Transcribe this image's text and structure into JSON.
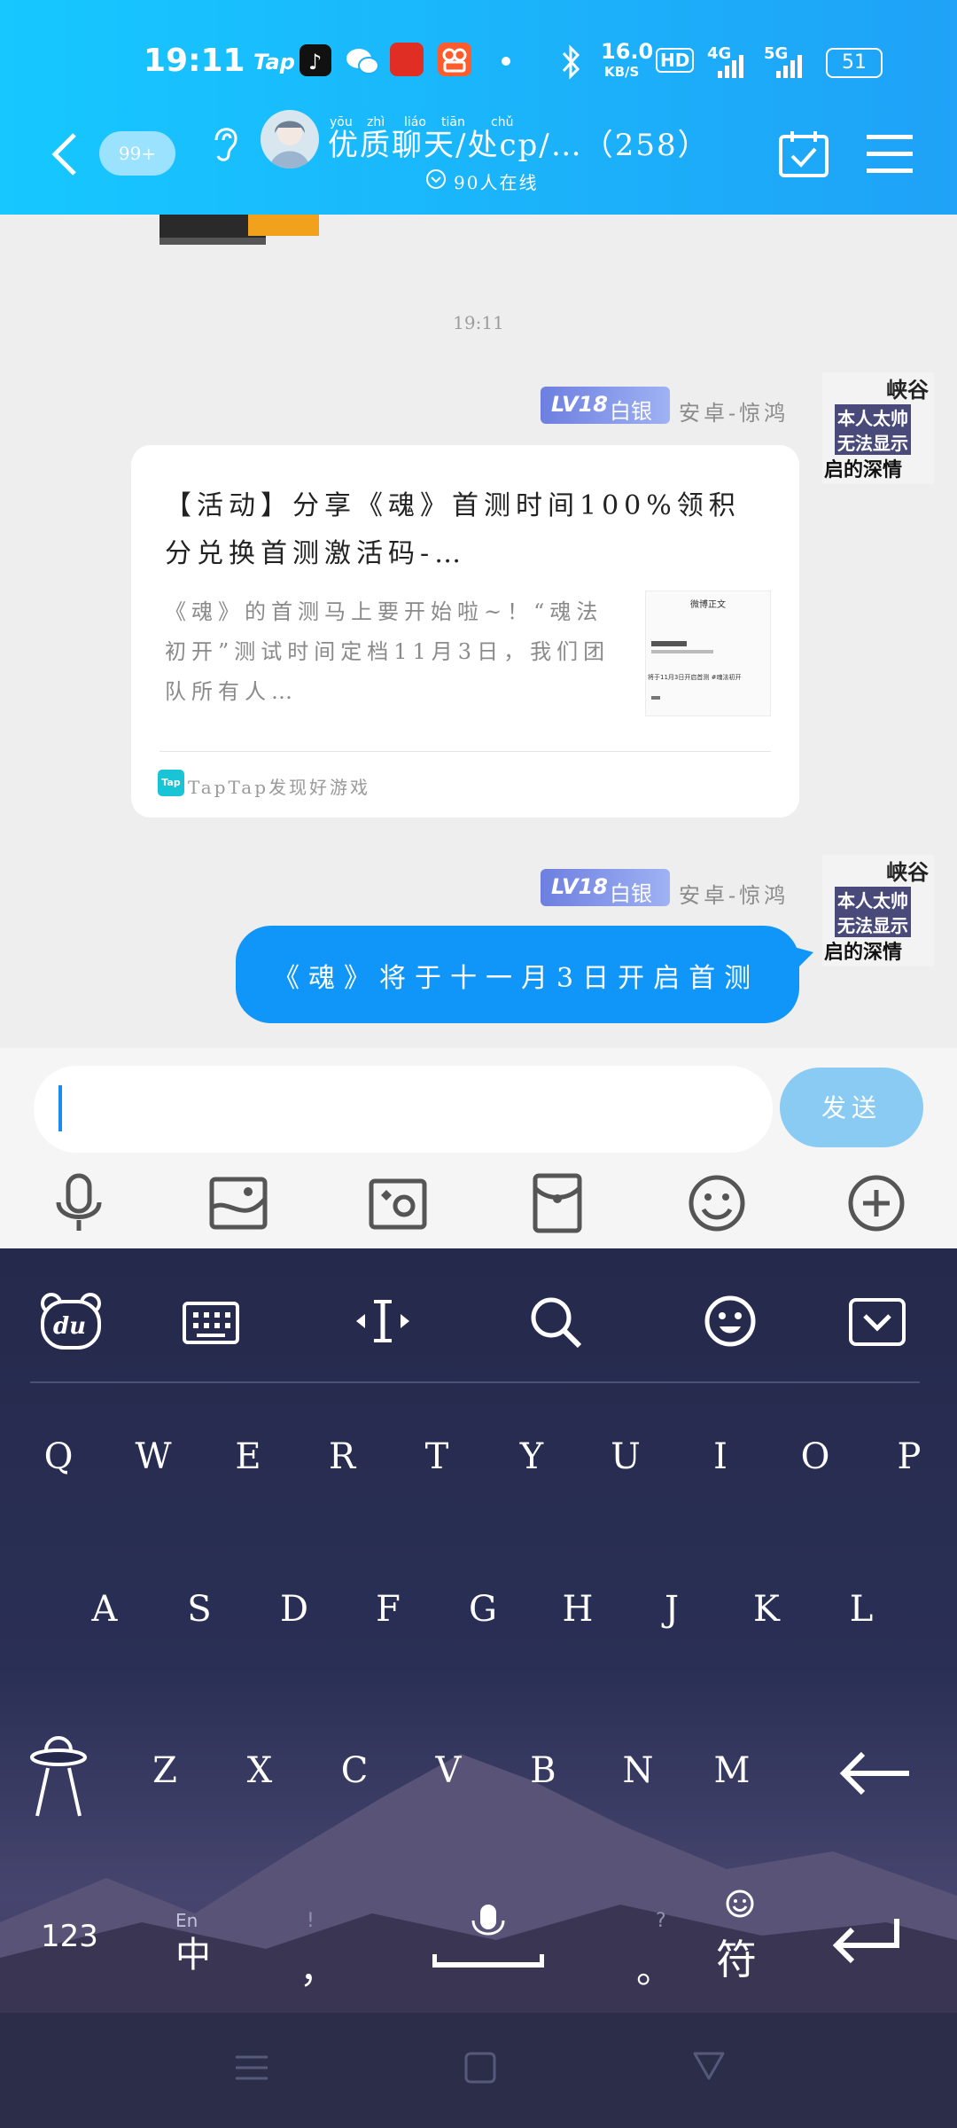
{
  "status_bar": {
    "time": "19:11",
    "app_icons": [
      "Tap",
      "tiktok-icon",
      "wechat-icon",
      "pinduoduo-icon",
      "kuaishou-icon"
    ],
    "network_speed": "16.0",
    "network_unit": "KB/S",
    "hd_label": "HD",
    "signal_1": "4G",
    "signal_2": "5G",
    "battery": "51"
  },
  "header": {
    "back_badge": "99+",
    "group_title": "优质聊天/处cp/…（258）",
    "online_count": "90人在线",
    "title_pinyin": [
      "yōu",
      "zhì",
      "liáo",
      "tiān",
      "chǔ"
    ]
  },
  "chat": {
    "timestamp": "19:11",
    "messages": [
      {
        "sender_level": "LV18",
        "sender_rank": "白银",
        "sender_name": "安卓-惊鸿",
        "avatar_text": [
          "峡谷",
          "本人太帅",
          "无法显示",
          "启的深情"
        ],
        "card": {
          "title": "【活动】分享《魂》首测时间100%领积分兑换首测激活码-…",
          "description": "《魂》的首测马上要开始啦~！“魂法初开”测试时间定档11月3日，我们团队所有人…",
          "thumb_title": "微博正文",
          "thumb_line": "将于11月3日开启首测 #魂法初开",
          "source_logo": "Tap",
          "source": "TapTap发现好游戏"
        }
      },
      {
        "sender_level": "LV18",
        "sender_rank": "白银",
        "sender_name": "安卓-惊鸿",
        "avatar_text": [
          "峡谷",
          "本人太帅",
          "无法显示",
          "启的深情"
        ],
        "text": "《魂》将于十一月3日开启首测"
      }
    ]
  },
  "input_bar": {
    "placeholder": "",
    "send_label": "发送",
    "tools": [
      "microphone-icon",
      "image-icon",
      "camera-icon",
      "red-packet-icon",
      "emoji-icon",
      "plus-icon"
    ]
  },
  "keyboard": {
    "toolbar": [
      "du-logo-icon",
      "keyboard-icon",
      "cursor-move-icon",
      "search-icon",
      "emoji-icon",
      "collapse-icon"
    ],
    "row1": [
      "Q",
      "W",
      "E",
      "R",
      "T",
      "Y",
      "U",
      "I",
      "O",
      "P"
    ],
    "row2": [
      "A",
      "S",
      "D",
      "F",
      "G",
      "H",
      "J",
      "K",
      "L"
    ],
    "row3": [
      "Z",
      "X",
      "C",
      "V",
      "B",
      "N",
      "M"
    ],
    "num_key": "123",
    "lang_key_top": "En",
    "lang_key_bottom": "中",
    "comma": "，",
    "comma_alt": "!",
    "period": "。",
    "period_alt": "?",
    "symbol_key": "符"
  },
  "colors": {
    "header_start": "#16c8ff",
    "header_end": "#1fa2f7",
    "bubble": "#0f96f8",
    "send_button": "#8acbf4",
    "keyboard_bg": "#252a4c"
  }
}
